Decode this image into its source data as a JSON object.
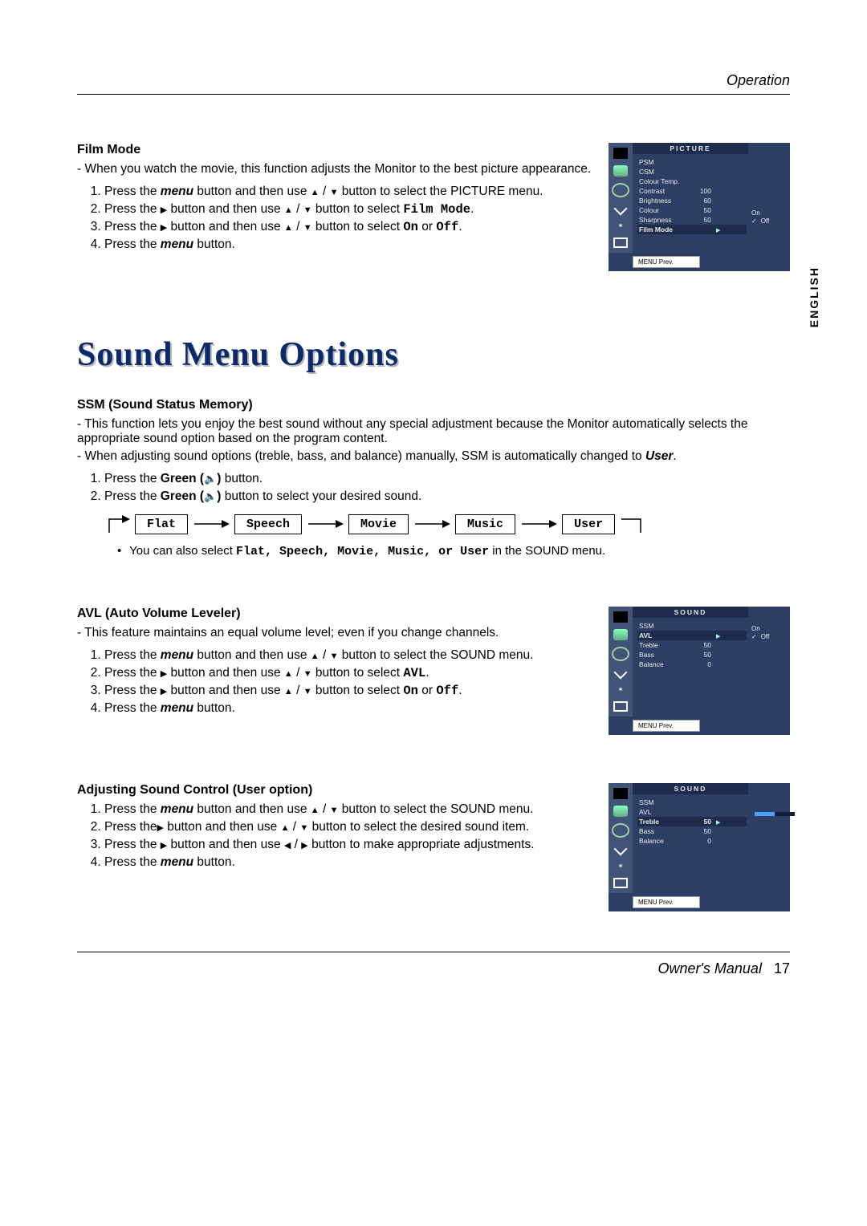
{
  "header": {
    "section": "Operation"
  },
  "language_tab": "ENGLISH",
  "film_mode": {
    "title": "Film Mode",
    "intro": "When you watch the movie, this function adjusts the Monitor to the best picture appearance.",
    "s1a": "Press the ",
    "s1b": "menu",
    "s1c": " button and then use ",
    "s1d": " button to select the PICTURE menu.",
    "s2a": "Press the ",
    "s2b": " button and then use ",
    "s2c": " button to select ",
    "s2d": "Film Mode",
    "s2e": ".",
    "s3a": "Press the ",
    "s3b": " button and then use ",
    "s3c": " button to select ",
    "s3d": "On",
    "s3e": " or ",
    "s3f": "Off",
    "s3g": ".",
    "s4a": "Press the ",
    "s4b": "menu",
    "s4c": " button."
  },
  "osd_picture": {
    "title": "PICTURE",
    "items": [
      {
        "label": "PSM",
        "value": ""
      },
      {
        "label": "CSM",
        "value": ""
      },
      {
        "label": "Colour Temp.",
        "value": ""
      },
      {
        "label": "Contrast",
        "value": "100"
      },
      {
        "label": "Brightness",
        "value": "60"
      },
      {
        "label": "Colour",
        "value": "50"
      },
      {
        "label": "Sharpness",
        "value": "50"
      },
      {
        "label": "Film Mode",
        "value": ""
      }
    ],
    "highlight_index": 7,
    "right_opts": [
      "On",
      "Off"
    ],
    "right_checked": "Off",
    "footer": "MENU Prev."
  },
  "sound_menu": {
    "title": "Sound Menu Options"
  },
  "ssm": {
    "title": "SSM (Sound Status Memory)",
    "p1": "This function lets you enjoy the best sound without any special adjustment because the Monitor automatically selects the appropriate sound option based on the program content.",
    "p2a": "When adjusting sound options (treble, bass, and balance) manually, SSM is automatically changed to ",
    "p2b": "User",
    "p2c": ".",
    "s1a": "Press the ",
    "s1b": "Green (",
    "s1c": ")",
    "s1d": " button.",
    "s2a": "Press the ",
    "s2b": "Green (",
    "s2c": ")",
    "s2d": " button to select your desired sound.",
    "cycle": [
      "Flat",
      "Speech",
      "Movie",
      "Music",
      "User"
    ],
    "note_a": "You can also select ",
    "note_b": " in the SOUND menu.",
    "note_list": "Flat, Speech, Movie, Music, or User"
  },
  "avl": {
    "title": "AVL (Auto Volume Leveler)",
    "intro": "This feature maintains an equal volume level; even if you change channels.",
    "s1a": "Press the ",
    "s1b": "menu",
    "s1c": " button and then use ",
    "s1d": " button to select the SOUND menu.",
    "s2a": "Press the ",
    "s2b": " button and then use ",
    "s2c": " button to select ",
    "s2d": "AVL",
    "s2e": ".",
    "s3a": "Press the ",
    "s3b": " button and then use ",
    "s3c": " button to select ",
    "s3d": "On",
    "s3e": " or ",
    "s3f": "Off",
    "s3g": ".",
    "s4a": "Press the ",
    "s4b": "menu",
    "s4c": " button."
  },
  "osd_sound_avl": {
    "title": "SOUND",
    "items": [
      {
        "label": "SSM",
        "value": ""
      },
      {
        "label": "AVL",
        "value": ""
      },
      {
        "label": "Treble",
        "value": "50"
      },
      {
        "label": "Bass",
        "value": "50"
      },
      {
        "label": "Balance",
        "value": "0"
      }
    ],
    "highlight_index": 1,
    "right_opts": [
      "On",
      "Off"
    ],
    "right_checked": "Off",
    "footer": "MENU Prev."
  },
  "adjust": {
    "title": "Adjusting Sound Control (User option)",
    "s1a": "Press the ",
    "s1b": "menu",
    "s1c": " button and then use ",
    "s1d": " button to select the SOUND menu.",
    "s2a": "Press the",
    "s2b": " button and then use ",
    "s2c": " button to select the desired sound item.",
    "s3a": "Press the ",
    "s3b": " button and then use ",
    "s3c": " button to make appropriate adjustments.",
    "s4a": "Press the ",
    "s4b": "menu",
    "s4c": " button."
  },
  "osd_sound_treble": {
    "title": "SOUND",
    "items": [
      {
        "label": "SSM",
        "value": ""
      },
      {
        "label": "AVL",
        "value": ""
      },
      {
        "label": "Treble",
        "value": "50"
      },
      {
        "label": "Bass",
        "value": "50"
      },
      {
        "label": "Balance",
        "value": "0"
      }
    ],
    "highlight_index": 2,
    "footer": "MENU Prev."
  },
  "footer": {
    "label": "Owner's Manual",
    "page": "17"
  }
}
